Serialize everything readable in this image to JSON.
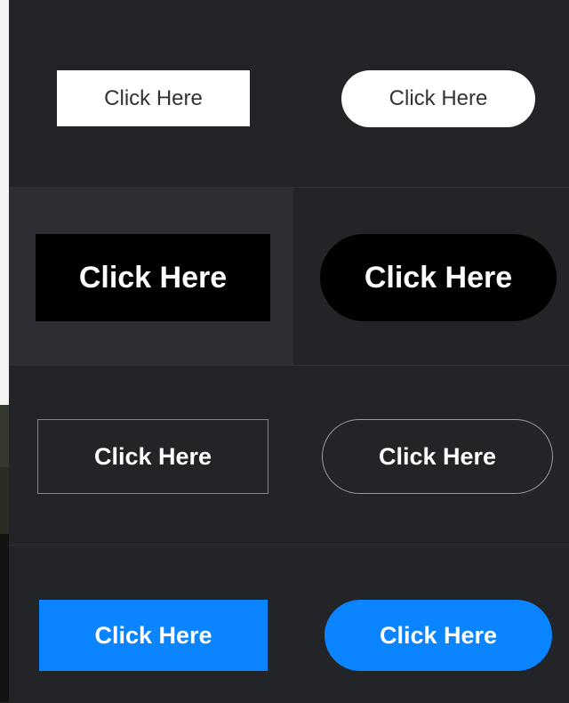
{
  "theme": {
    "page_background": "#232427",
    "panel_highlight": "#2c2e33",
    "white": "#ffffff",
    "black": "#000000",
    "blue": "#0a84ff"
  },
  "rows": [
    {
      "left_label": "Click Here",
      "right_label": "Click Here"
    },
    {
      "left_label": "Click Here",
      "right_label": "Click Here"
    },
    {
      "left_label": "Click Here",
      "right_label": "Click Here"
    },
    {
      "left_label": "Click Here",
      "right_label": "Click Here"
    }
  ]
}
